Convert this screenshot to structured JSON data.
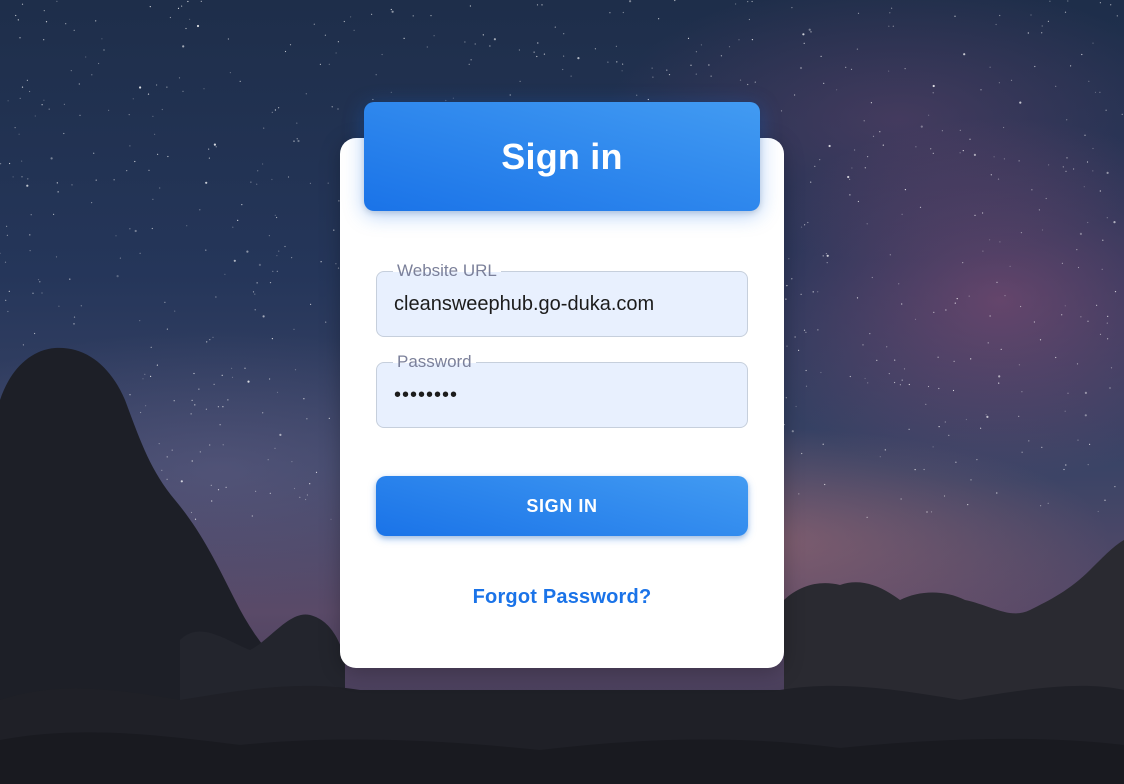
{
  "header": {
    "title": "Sign in"
  },
  "form": {
    "website_url": {
      "label": "Website URL",
      "value": "cleansweephub.go-duka.com"
    },
    "password": {
      "label": "Password",
      "value": "12345678"
    },
    "submit_label": "SIGN IN",
    "forgot_label": "Forgot Password?"
  },
  "colors": {
    "accent": "#1a73e8",
    "accent_light": "#429bf2",
    "input_bg": "#e8f0fe"
  }
}
